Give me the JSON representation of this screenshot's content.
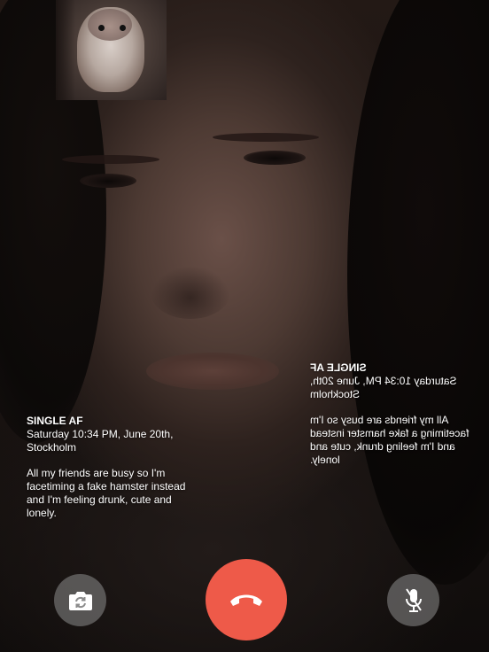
{
  "caption": {
    "title": "SINGLE AF",
    "meta_line1": "Saturday 10:34 PM, June 20th,",
    "meta_line2": "Stockholm",
    "body": "All my friends are busy so I'm facetiming a fake hamster instead and I'm feeling drunk, cute and lonely."
  },
  "controls": {
    "flip_camera_icon": "camera-flip-icon",
    "end_call_icon": "phone-hangup-icon",
    "mute_icon": "microphone-off-icon",
    "end_call_color": "#ee5a49"
  }
}
